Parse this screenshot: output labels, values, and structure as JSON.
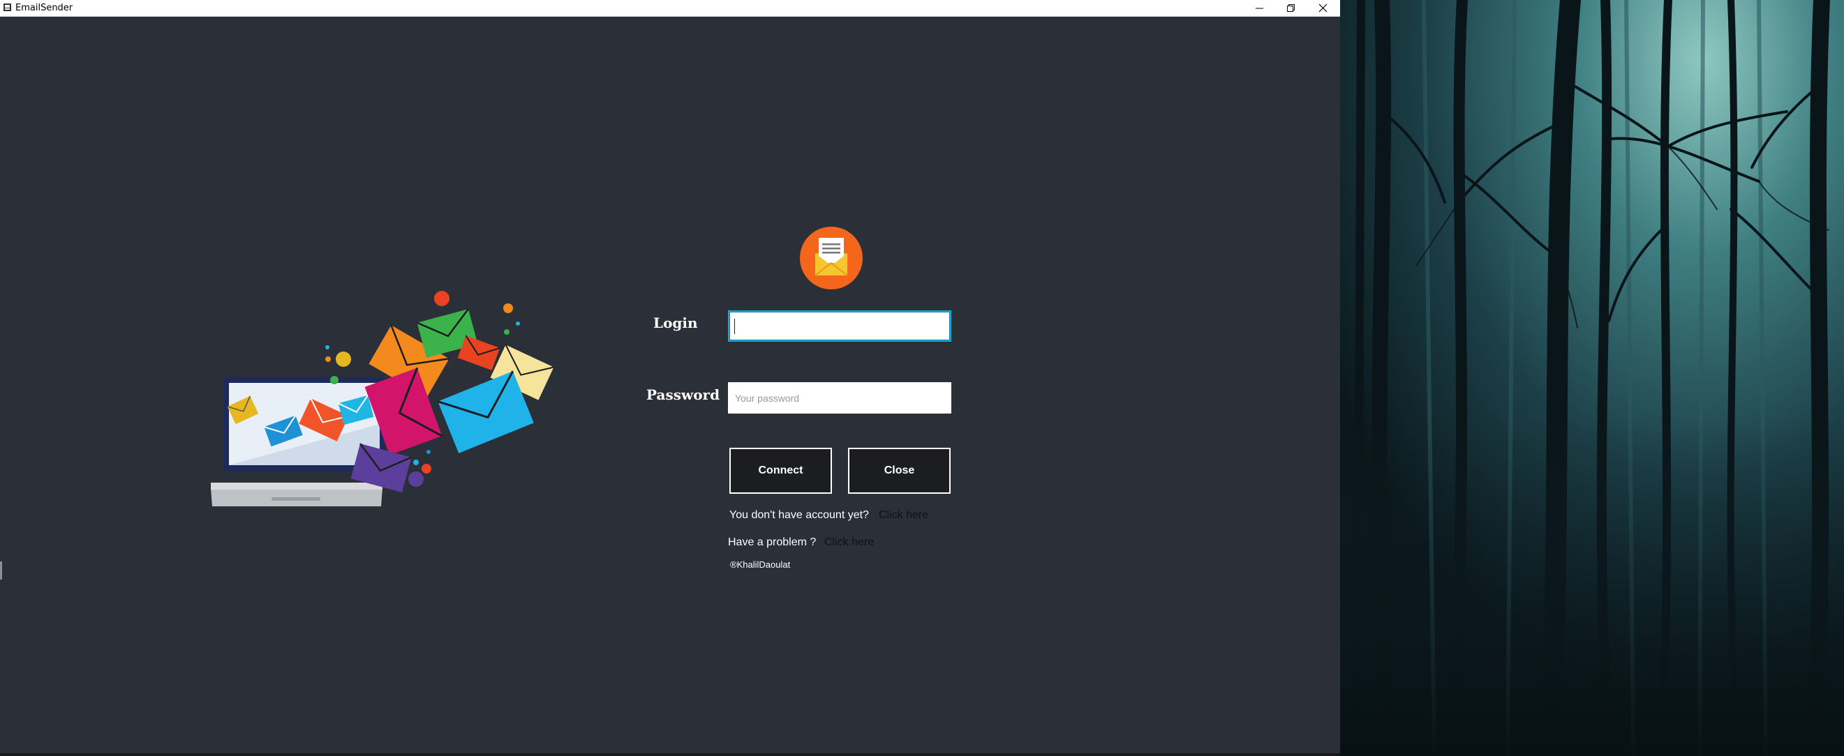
{
  "window": {
    "title": "EmailSender",
    "icons": {
      "app": "app-icon",
      "minimize": "minimize-icon",
      "maximize": "restore-icon",
      "close": "close-icon"
    }
  },
  "illustration": {
    "name": "laptop-with-emails-illustration"
  },
  "form": {
    "logo": "envelope-logo-icon",
    "login_label": "Login",
    "login_value": "",
    "password_label": "Password",
    "password_placeholder": "Your password",
    "connect_label": "Connect",
    "close_label": "Close",
    "no_account_text": "You don't have account yet?",
    "no_account_link": "Click here",
    "problem_text": "Have a problem ?",
    "problem_link": "Click here",
    "copyright": "®KhalilDaoulat"
  },
  "colors": {
    "app_background": "#2a2f38",
    "logo_orange": "#f3661c",
    "input_focus_border": "#1aa9d6",
    "button_background": "#1b1d21"
  }
}
